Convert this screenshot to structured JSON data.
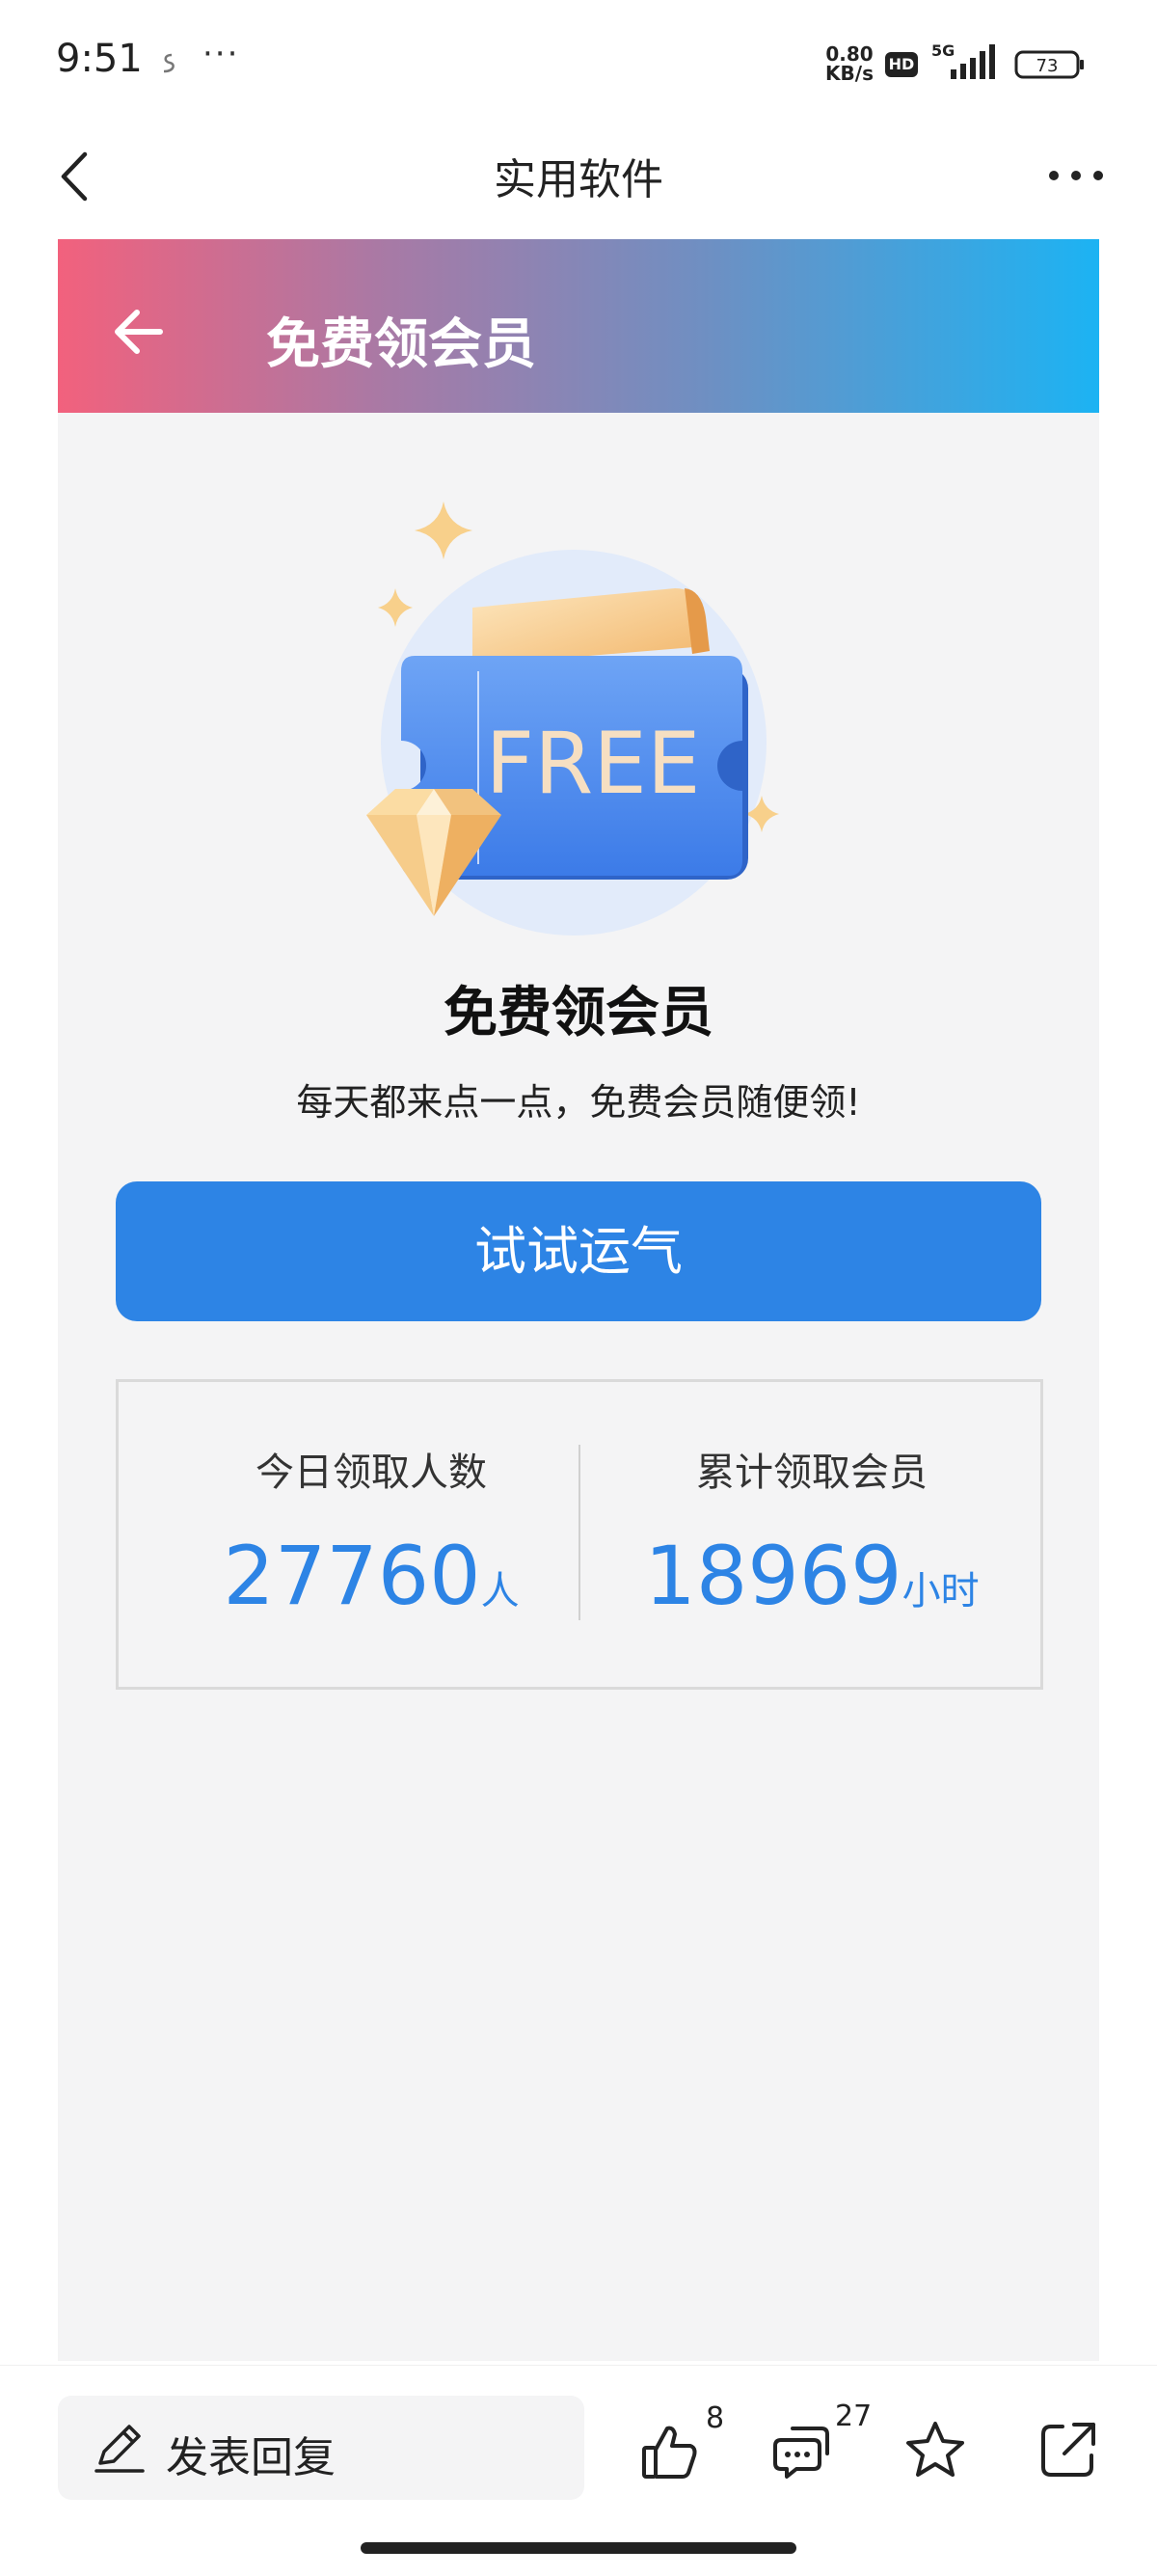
{
  "status_bar": {
    "time": "9:51",
    "more": "···",
    "speed_value": "0.80",
    "speed_unit": "KB/s",
    "hd_label": "HD",
    "network": "5G",
    "battery": "73"
  },
  "top_nav": {
    "title": "实用软件",
    "back_icon": "chevron-left-icon",
    "more_icon": "more-dots-icon"
  },
  "banner": {
    "title": "免费领会员",
    "back_icon": "arrow-left-icon",
    "gradient_start": "#f2617d",
    "gradient_end": "#1cb3f3"
  },
  "hero": {
    "ticket_text": "FREE",
    "title": "免费领会员",
    "subtitle": "每天都来点一点，免费会员随便领!"
  },
  "action": {
    "button_label": "试试运气",
    "button_color": "#2d84e5"
  },
  "stats": {
    "today": {
      "label": "今日领取人数",
      "value": "27760",
      "unit": "人"
    },
    "total": {
      "label": "累计领取会员",
      "value": "18969",
      "unit": "小时"
    }
  },
  "bottom_bar": {
    "reply_label": "发表回复",
    "likes": "8",
    "comments": "27",
    "icons": [
      "pen-icon",
      "thumbs-up-icon",
      "comment-icon",
      "star-icon",
      "share-icon"
    ]
  }
}
